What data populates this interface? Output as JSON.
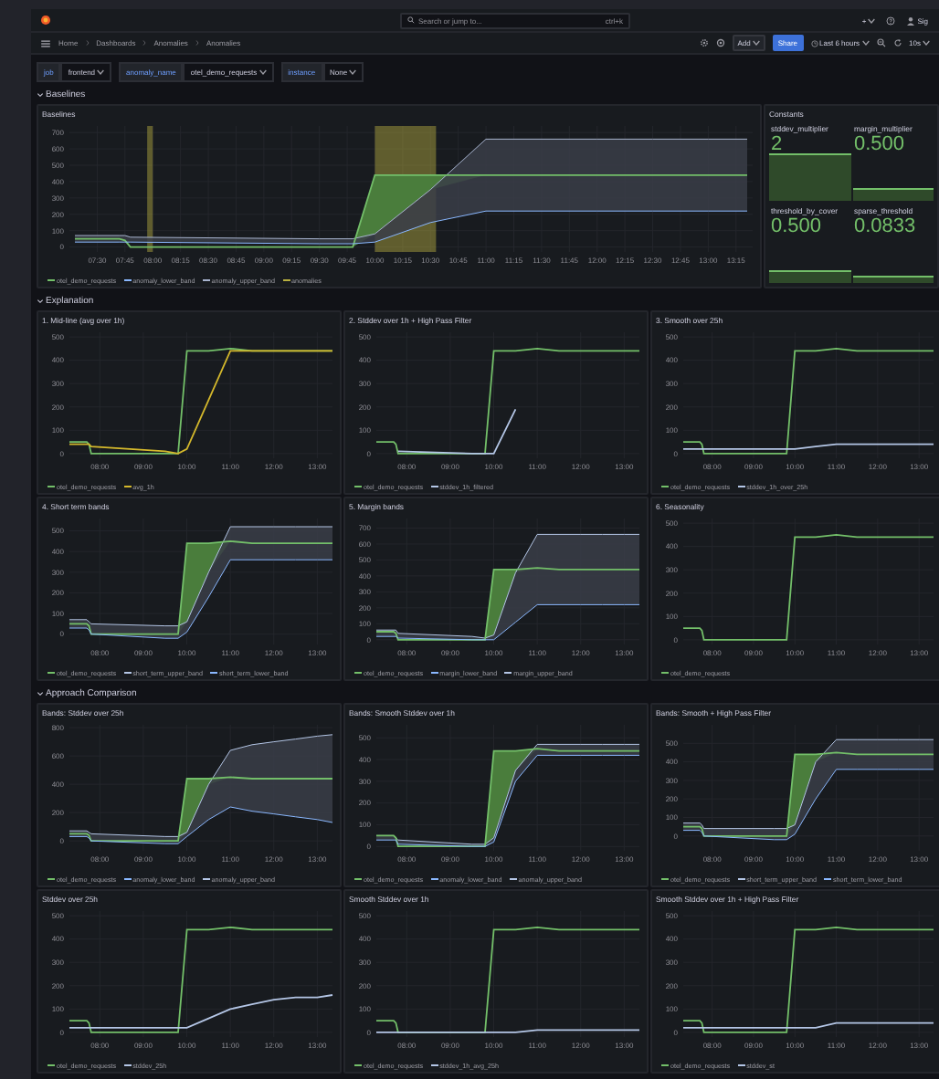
{
  "topbar": {
    "search": {
      "placeholder": "Search or jump to..."
    },
    "shortcut": "ctrl+k",
    "new_button": "+",
    "user": "Sig"
  },
  "toolbar": {
    "breadcrumbs": [
      "Home",
      "Dashboards",
      "Anomalies",
      "Anomalies"
    ],
    "add": "Add",
    "share": "Share",
    "time_range": "Last 6 hours",
    "refresh": "10s"
  },
  "variables": [
    {
      "label": "job",
      "value": "frontend"
    },
    {
      "label": "anomaly_name",
      "value": "otel_demo_requests"
    },
    {
      "label": "instance",
      "value": "None"
    }
  ],
  "rows": [
    {
      "title": "Baselines",
      "expanded": true,
      "panels": [
        {
          "kind": "timeseries",
          "title": "Baselines",
          "chart_data": {
            "type": "line",
            "grid": true,
            "legend": "bottom",
            "x": [
              7.3,
              7.7,
              7.75,
              7.8,
              9.5,
              9.8,
              10,
              10.5,
              11,
              11.5,
              12,
              12.5,
              13,
              13.35
            ],
            "xlim": [
              7.25,
              13.4
            ],
            "ylim": [
              -30,
              740
            ],
            "xticks": [
              {
                "value": 7.5,
                "label": "07:30"
              },
              {
                "value": 7.75,
                "label": "07:45"
              },
              {
                "value": 8,
                "label": "08:00"
              },
              {
                "value": 8.25,
                "label": "08:15"
              },
              {
                "value": 8.5,
                "label": "08:30"
              },
              {
                "value": 8.75,
                "label": "08:45"
              },
              {
                "value": 9,
                "label": "09:00"
              },
              {
                "value": 9.25,
                "label": "09:15"
              },
              {
                "value": 9.5,
                "label": "09:30"
              },
              {
                "value": 9.75,
                "label": "09:45"
              },
              {
                "value": 10,
                "label": "10:00"
              },
              {
                "value": 10.25,
                "label": "10:15"
              },
              {
                "value": 10.5,
                "label": "10:30"
              },
              {
                "value": 10.75,
                "label": "10:45"
              },
              {
                "value": 11,
                "label": "11:00"
              },
              {
                "value": 11.25,
                "label": "11:15"
              },
              {
                "value": 11.5,
                "label": "11:30"
              },
              {
                "value": 11.75,
                "label": "11:45"
              },
              {
                "value": 12,
                "label": "12:00"
              },
              {
                "value": 12.25,
                "label": "12:15"
              },
              {
                "value": 12.5,
                "label": "12:30"
              },
              {
                "value": 12.75,
                "label": "12:45"
              },
              {
                "value": 13,
                "label": "13:00"
              },
              {
                "value": 13.25,
                "label": "13:15"
              }
            ],
            "yticks": [
              0,
              100,
              200,
              300,
              400,
              500,
              600,
              700
            ],
            "series": [
              {
                "name": "otel_demo_requests",
                "color": "#73bf69",
                "values": [
                  50,
                  50,
                  40,
                  0,
                  0,
                  0,
                  440,
                  440,
                  440,
                  440,
                  440,
                  440,
                  440,
                  440
                ]
              },
              {
                "name": "anomaly_lower_band",
                "color": "#8ab8ff",
                "values": [
                  30,
                  30,
                  30,
                  30,
                  20,
                  20,
                  30,
                  150,
                  220,
                  220,
                  220,
                  220,
                  220,
                  220
                ]
              },
              {
                "name": "anomaly_upper_band",
                "type": "area",
                "color": "#a8b4cf",
                "values": [
                  70,
                  70,
                  70,
                  60,
                  50,
                  50,
                  80,
                  350,
                  660,
                  660,
                  660,
                  660,
                  660,
                  660
                ]
              },
              {
                "name": "anomalies",
                "color": "#b8b040",
                "values": [
                  null,
                  null,
                  null,
                  null,
                  null,
                  null,
                  null,
                  null,
                  null,
                  null,
                  null,
                  null,
                  null,
                  null
                ]
              }
            ],
            "bands": [
              {
                "axis": "x",
                "from": 7.95,
                "to": 8.0
              },
              {
                "axis": "x",
                "from": 10.0,
                "to": 10.55
              }
            ]
          }
        },
        {
          "kind": "stats",
          "title": "Constants",
          "stats": [
            {
              "name": "stddev_multiplier",
              "value": "2"
            },
            {
              "name": "margin_multiplier",
              "value": "0.500"
            },
            {
              "name": "threshold_by_cover",
              "value": "0.500"
            },
            {
              "name": "sparse_threshold",
              "value": "0.0833"
            }
          ]
        }
      ]
    },
    {
      "title": "Explanation",
      "expanded": true,
      "panels": [
        {
          "kind": "timeseries",
          "title": "1. Mid-line (avg over 1h)",
          "chart_data": {
            "type": "line",
            "grid": true,
            "legend": "bottom",
            "x": [
              7.3,
              7.7,
              7.75,
              7.8,
              9.5,
              9.8,
              10,
              10.5,
              11,
              11.5,
              12,
              12.5,
              13,
              13.35
            ],
            "xlim": [
              7.3,
              13.35
            ],
            "ylim": [
              -20,
              520
            ],
            "xticks": [
              {
                "value": 8,
                "label": "08:00"
              },
              {
                "value": 9,
                "label": "09:00"
              },
              {
                "value": 10,
                "label": "10:00"
              },
              {
                "value": 11,
                "label": "11:00"
              },
              {
                "value": 12,
                "label": "12:00"
              },
              {
                "value": 13,
                "label": "13:00"
              }
            ],
            "yticks": [
              0,
              100,
              200,
              300,
              400,
              500
            ],
            "series": [
              {
                "name": "otel_demo_requests",
                "color": "#73bf69",
                "values": [
                  50,
                  50,
                  40,
                  0,
                  0,
                  0,
                  440,
                  440,
                  450,
                  440,
                  440,
                  440,
                  440,
                  440
                ]
              },
              {
                "name": "avg_1h",
                "color": "#d4b82c",
                "values": [
                  40,
                  40,
                  40,
                  30,
                  10,
                  0,
                  20,
                  230,
                  440,
                  440,
                  440,
                  440,
                  440,
                  440
                ]
              }
            ]
          }
        },
        {
          "kind": "timeseries",
          "title": "2. Stddev over 1h + High Pass Filter",
          "chart_data": {
            "type": "line",
            "grid": true,
            "legend": "bottom",
            "x": [
              7.3,
              7.7,
              7.75,
              7.8,
              9.5,
              9.8,
              10,
              10.5,
              11,
              11.5,
              12,
              12.5,
              13,
              13.35
            ],
            "xlim": [
              7.3,
              13.35
            ],
            "ylim": [
              -20,
              520
            ],
            "xticks": [
              {
                "value": 8,
                "label": "08:00"
              },
              {
                "value": 9,
                "label": "09:00"
              },
              {
                "value": 10,
                "label": "10:00"
              },
              {
                "value": 11,
                "label": "11:00"
              },
              {
                "value": 12,
                "label": "12:00"
              },
              {
                "value": 13,
                "label": "13:00"
              }
            ],
            "yticks": [
              0,
              100,
              200,
              300,
              400,
              500
            ],
            "series": [
              {
                "name": "otel_demo_requests",
                "color": "#73bf69",
                "values": [
                  50,
                  50,
                  40,
                  0,
                  0,
                  0,
                  440,
                  440,
                  450,
                  440,
                  440,
                  440,
                  440,
                  440
                ]
              },
              {
                "name": "stddev_1h_filtered",
                "color": "#b4c6e6",
                "values": [
                  null,
                  null,
                  null,
                  10,
                  0,
                  0,
                  0,
                  190,
                  null,
                  null,
                  null,
                  null,
                  null,
                  null
                ]
              }
            ]
          }
        },
        {
          "kind": "timeseries",
          "title": "3. Smooth over 25h",
          "chart_data": {
            "type": "line",
            "grid": true,
            "legend": "bottom",
            "x": [
              7.3,
              7.7,
              7.75,
              7.8,
              9.5,
              9.8,
              10,
              10.5,
              11,
              11.5,
              12,
              12.5,
              13,
              13.35
            ],
            "xlim": [
              7.3,
              13.35
            ],
            "ylim": [
              -20,
              520
            ],
            "xticks": [
              {
                "value": 8,
                "label": "08:00"
              },
              {
                "value": 9,
                "label": "09:00"
              },
              {
                "value": 10,
                "label": "10:00"
              },
              {
                "value": 11,
                "label": "11:00"
              },
              {
                "value": 12,
                "label": "12:00"
              },
              {
                "value": 13,
                "label": "13:00"
              }
            ],
            "yticks": [
              0,
              100,
              200,
              300,
              400,
              500
            ],
            "series": [
              {
                "name": "otel_demo_requests",
                "color": "#73bf69",
                "values": [
                  50,
                  50,
                  40,
                  0,
                  0,
                  0,
                  440,
                  440,
                  450,
                  440,
                  440,
                  440,
                  440,
                  440
                ]
              },
              {
                "name": "stddev_1h_over_25h",
                "color": "#b4c6e6",
                "values": [
                  20,
                  20,
                  20,
                  20,
                  20,
                  20,
                  20,
                  30,
                  40,
                  40,
                  40,
                  40,
                  40,
                  40
                ]
              }
            ]
          }
        },
        {
          "kind": "timeseries",
          "title": "4. Short term bands",
          "chart_data": {
            "type": "line",
            "grid": true,
            "legend": "bottom",
            "x": [
              7.3,
              7.7,
              7.75,
              7.8,
              9.5,
              9.8,
              10,
              10.5,
              11,
              11.5,
              12,
              12.5,
              13,
              13.35
            ],
            "xlim": [
              7.3,
              13.35
            ],
            "ylim": [
              -50,
              560
            ],
            "xticks": [
              {
                "value": 8,
                "label": "08:00"
              },
              {
                "value": 9,
                "label": "09:00"
              },
              {
                "value": 10,
                "label": "10:00"
              },
              {
                "value": 11,
                "label": "11:00"
              },
              {
                "value": 12,
                "label": "12:00"
              },
              {
                "value": 13,
                "label": "13:00"
              }
            ],
            "yticks": [
              0,
              100,
              200,
              300,
              400,
              500
            ],
            "series": [
              {
                "name": "otel_demo_requests",
                "color": "#73bf69",
                "values": [
                  50,
                  50,
                  40,
                  0,
                  0,
                  0,
                  440,
                  440,
                  450,
                  440,
                  440,
                  440,
                  440,
                  440
                ]
              },
              {
                "name": "short_term_upper_band",
                "type": "area",
                "color": "#b4c6e6",
                "values": [
                  70,
                  70,
                  60,
                  50,
                  40,
                  40,
                  60,
                  300,
                  520,
                  520,
                  520,
                  520,
                  520,
                  520
                ]
              },
              {
                "name": "short_term_lower_band",
                "color": "#8ab8ff",
                "values": [
                  30,
                  30,
                  20,
                  0,
                  -20,
                  -20,
                  10,
                  180,
                  360,
                  360,
                  360,
                  360,
                  360,
                  360
                ]
              }
            ]
          }
        },
        {
          "kind": "timeseries",
          "title": "5. Margin bands",
          "chart_data": {
            "type": "line",
            "grid": true,
            "legend": "bottom",
            "x": [
              7.3,
              7.7,
              7.75,
              7.8,
              9.5,
              9.8,
              10,
              10.5,
              11,
              11.5,
              12,
              12.5,
              13,
              13.35
            ],
            "xlim": [
              7.3,
              13.35
            ],
            "ylim": [
              -30,
              760
            ],
            "xticks": [
              {
                "value": 8,
                "label": "08:00"
              },
              {
                "value": 9,
                "label": "09:00"
              },
              {
                "value": 10,
                "label": "10:00"
              },
              {
                "value": 11,
                "label": "11:00"
              },
              {
                "value": 12,
                "label": "12:00"
              },
              {
                "value": 13,
                "label": "13:00"
              }
            ],
            "yticks": [
              0,
              100,
              200,
              300,
              400,
              500,
              600,
              700
            ],
            "series": [
              {
                "name": "otel_demo_requests",
                "color": "#73bf69",
                "values": [
                  50,
                  50,
                  40,
                  0,
                  0,
                  0,
                  440,
                  440,
                  450,
                  440,
                  440,
                  440,
                  440,
                  440
                ]
              },
              {
                "name": "margin_lower_band",
                "color": "#8ab8ff",
                "values": [
                  20,
                  20,
                  20,
                  10,
                  0,
                  0,
                  0,
                  110,
                  220,
                  220,
                  220,
                  220,
                  220,
                  220
                ]
              },
              {
                "name": "margin_upper_band",
                "type": "area",
                "color": "#b4c6e6",
                "values": [
                  60,
                  60,
                  60,
                  40,
                  20,
                  10,
                  30,
                  420,
                  660,
                  660,
                  660,
                  660,
                  660,
                  660
                ]
              }
            ]
          }
        },
        {
          "kind": "timeseries",
          "title": "6. Seasonality",
          "chart_data": {
            "type": "line",
            "grid": true,
            "legend": "bottom",
            "x": [
              7.3,
              7.7,
              7.75,
              7.8,
              9.5,
              9.8,
              10,
              10.5,
              11,
              11.5,
              12,
              12.5,
              13,
              13.35
            ],
            "xlim": [
              7.3,
              13.35
            ],
            "ylim": [
              -20,
              520
            ],
            "xticks": [
              {
                "value": 8,
                "label": "08:00"
              },
              {
                "value": 9,
                "label": "09:00"
              },
              {
                "value": 10,
                "label": "10:00"
              },
              {
                "value": 11,
                "label": "11:00"
              },
              {
                "value": 12,
                "label": "12:00"
              },
              {
                "value": 13,
                "label": "13:00"
              }
            ],
            "yticks": [
              0,
              100,
              200,
              300,
              400,
              500
            ],
            "series": [
              {
                "name": "otel_demo_requests",
                "color": "#73bf69",
                "values": [
                  50,
                  50,
                  40,
                  0,
                  0,
                  0,
                  440,
                  440,
                  450,
                  440,
                  440,
                  440,
                  440,
                  440
                ]
              }
            ]
          }
        }
      ]
    },
    {
      "title": "Approach Comparison",
      "expanded": true,
      "panels": [
        {
          "kind": "timeseries",
          "title": "Bands: Stddev over 25h",
          "chart_data": {
            "type": "line",
            "grid": true,
            "legend": "bottom",
            "x": [
              7.3,
              7.7,
              7.75,
              7.8,
              9.5,
              9.8,
              10,
              10.5,
              11,
              11.5,
              12,
              12.5,
              13,
              13.35
            ],
            "xlim": [
              7.3,
              13.35
            ],
            "ylim": [
              -70,
              820
            ],
            "xticks": [
              {
                "value": 8,
                "label": "08:00"
              },
              {
                "value": 9,
                "label": "09:00"
              },
              {
                "value": 10,
                "label": "10:00"
              },
              {
                "value": 11,
                "label": "11:00"
              },
              {
                "value": 12,
                "label": "12:00"
              },
              {
                "value": 13,
                "label": "13:00"
              }
            ],
            "yticks": [
              0,
              200,
              400,
              600,
              800
            ],
            "series": [
              {
                "name": "otel_demo_requests",
                "color": "#73bf69",
                "values": [
                  50,
                  50,
                  40,
                  0,
                  0,
                  0,
                  440,
                  440,
                  450,
                  440,
                  440,
                  440,
                  440,
                  440
                ]
              },
              {
                "name": "anomaly_lower_band",
                "color": "#8ab8ff",
                "values": [
                  30,
                  30,
                  20,
                  0,
                  -20,
                  -20,
                  30,
                  150,
                  240,
                  210,
                  190,
                  170,
                  150,
                  130
                ]
              },
              {
                "name": "anomaly_upper_band",
                "type": "area",
                "color": "#b4c6e6",
                "values": [
                  70,
                  70,
                  60,
                  50,
                  30,
                  30,
                  60,
                  400,
                  640,
                  680,
                  700,
                  720,
                  740,
                  750
                ]
              }
            ]
          }
        },
        {
          "kind": "timeseries",
          "title": "Bands: Smooth Stddev over 1h",
          "chart_data": {
            "type": "line",
            "grid": true,
            "legend": "bottom",
            "x": [
              7.3,
              7.7,
              7.75,
              7.8,
              9.5,
              9.8,
              10,
              10.5,
              11,
              11.5,
              12,
              12.5,
              13,
              13.35
            ],
            "xlim": [
              7.3,
              13.35
            ],
            "ylim": [
              -20,
              560
            ],
            "xticks": [
              {
                "value": 8,
                "label": "08:00"
              },
              {
                "value": 9,
                "label": "09:00"
              },
              {
                "value": 10,
                "label": "10:00"
              },
              {
                "value": 11,
                "label": "11:00"
              },
              {
                "value": 12,
                "label": "12:00"
              },
              {
                "value": 13,
                "label": "13:00"
              }
            ],
            "yticks": [
              0,
              100,
              200,
              300,
              400,
              500
            ],
            "series": [
              {
                "name": "otel_demo_requests",
                "color": "#73bf69",
                "values": [
                  50,
                  50,
                  40,
                  0,
                  0,
                  0,
                  440,
                  440,
                  450,
                  440,
                  440,
                  440,
                  440,
                  440
                ]
              },
              {
                "name": "anomaly_lower_band",
                "color": "#8ab8ff",
                "values": [
                  30,
                  30,
                  30,
                  10,
                  0,
                  0,
                  20,
                  300,
                  420,
                  420,
                  420,
                  420,
                  420,
                  420
                ]
              },
              {
                "name": "anomaly_upper_band",
                "type": "area",
                "color": "#b4c6e6",
                "values": [
                  50,
                  50,
                  40,
                  30,
                  10,
                  10,
                  40,
                  350,
                  470,
                  470,
                  470,
                  470,
                  470,
                  470
                ]
              }
            ]
          }
        },
        {
          "kind": "timeseries",
          "title": "Bands: Smooth + High Pass Filter",
          "chart_data": {
            "type": "line",
            "grid": true,
            "legend": "bottom",
            "x": [
              7.3,
              7.7,
              7.75,
              7.8,
              9.5,
              9.8,
              10,
              10.5,
              11,
              11.5,
              12,
              12.5,
              13,
              13.35
            ],
            "xlim": [
              7.3,
              13.35
            ],
            "ylim": [
              -80,
              600
            ],
            "xticks": [
              {
                "value": 8,
                "label": "08:00"
              },
              {
                "value": 9,
                "label": "09:00"
              },
              {
                "value": 10,
                "label": "10:00"
              },
              {
                "value": 11,
                "label": "11:00"
              },
              {
                "value": 12,
                "label": "12:00"
              },
              {
                "value": 13,
                "label": "13:00"
              }
            ],
            "yticks": [
              0,
              100,
              200,
              300,
              400,
              500
            ],
            "series": [
              {
                "name": "otel_demo_requests",
                "color": "#73bf69",
                "values": [
                  50,
                  50,
                  40,
                  0,
                  0,
                  0,
                  440,
                  440,
                  450,
                  440,
                  440,
                  440,
                  440,
                  440
                ]
              },
              {
                "name": "short_term_upper_band",
                "type": "area",
                "color": "#b4c6e6",
                "values": [
                  70,
                  70,
                  60,
                  40,
                  40,
                  40,
                  60,
                  400,
                  520,
                  520,
                  520,
                  520,
                  520,
                  520
                ]
              },
              {
                "name": "short_term_lower_band",
                "color": "#8ab8ff",
                "values": [
                  30,
                  30,
                  20,
                  0,
                  -20,
                  -20,
                  10,
                  200,
                  360,
                  360,
                  360,
                  360,
                  360,
                  360
                ]
              }
            ]
          }
        },
        {
          "kind": "timeseries",
          "title": "Stddev over 25h",
          "chart_data": {
            "type": "line",
            "grid": true,
            "legend": "bottom",
            "x": [
              7.3,
              7.7,
              7.75,
              7.8,
              9.5,
              9.8,
              10,
              10.5,
              11,
              11.5,
              12,
              12.5,
              13,
              13.35
            ],
            "xlim": [
              7.3,
              13.35
            ],
            "ylim": [
              -20,
              520
            ],
            "xticks": [
              {
                "value": 8,
                "label": "08:00"
              },
              {
                "value": 9,
                "label": "09:00"
              },
              {
                "value": 10,
                "label": "10:00"
              },
              {
                "value": 11,
                "label": "11:00"
              },
              {
                "value": 12,
                "label": "12:00"
              },
              {
                "value": 13,
                "label": "13:00"
              }
            ],
            "yticks": [
              0,
              100,
              200,
              300,
              400,
              500
            ],
            "series": [
              {
                "name": "otel_demo_requests",
                "color": "#73bf69",
                "values": [
                  50,
                  50,
                  40,
                  0,
                  0,
                  0,
                  440,
                  440,
                  450,
                  440,
                  440,
                  440,
                  440,
                  440
                ]
              },
              {
                "name": "stddev_25h",
                "color": "#b4c6e6",
                "values": [
                  20,
                  20,
                  20,
                  20,
                  20,
                  20,
                  20,
                  60,
                  100,
                  120,
                  140,
                  150,
                  150,
                  160
                ]
              }
            ]
          }
        },
        {
          "kind": "timeseries",
          "title": "Smooth Stddev over 1h",
          "chart_data": {
            "type": "line",
            "grid": true,
            "legend": "bottom",
            "x": [
              7.3,
              7.7,
              7.75,
              7.8,
              9.5,
              9.8,
              10,
              10.5,
              11,
              11.5,
              12,
              12.5,
              13,
              13.35
            ],
            "xlim": [
              7.3,
              13.35
            ],
            "ylim": [
              -20,
              520
            ],
            "xticks": [
              {
                "value": 8,
                "label": "08:00"
              },
              {
                "value": 9,
                "label": "09:00"
              },
              {
                "value": 10,
                "label": "10:00"
              },
              {
                "value": 11,
                "label": "11:00"
              },
              {
                "value": 12,
                "label": "12:00"
              },
              {
                "value": 13,
                "label": "13:00"
              }
            ],
            "yticks": [
              0,
              100,
              200,
              300,
              400,
              500
            ],
            "series": [
              {
                "name": "otel_demo_requests",
                "color": "#73bf69",
                "values": [
                  50,
                  50,
                  40,
                  0,
                  0,
                  0,
                  440,
                  440,
                  450,
                  440,
                  440,
                  440,
                  440,
                  440
                ]
              },
              {
                "name": "stddev_1h_avg_25h",
                "color": "#b4c6e6",
                "values": [
                  0,
                  0,
                  0,
                  0,
                  0,
                  0,
                  0,
                  0,
                  10,
                  10,
                  10,
                  10,
                  10,
                  10
                ]
              }
            ]
          }
        },
        {
          "kind": "timeseries",
          "title": "Smooth Stddev over 1h + High Pass Filter",
          "chart_data": {
            "type": "line",
            "grid": true,
            "legend": "bottom",
            "x": [
              7.3,
              7.7,
              7.75,
              7.8,
              9.5,
              9.8,
              10,
              10.5,
              11,
              11.5,
              12,
              12.5,
              13,
              13.35
            ],
            "xlim": [
              7.3,
              13.35
            ],
            "ylim": [
              -20,
              520
            ],
            "xticks": [
              {
                "value": 8,
                "label": "08:00"
              },
              {
                "value": 9,
                "label": "09:00"
              },
              {
                "value": 10,
                "label": "10:00"
              },
              {
                "value": 11,
                "label": "11:00"
              },
              {
                "value": 12,
                "label": "12:00"
              },
              {
                "value": 13,
                "label": "13:00"
              }
            ],
            "yticks": [
              0,
              100,
              200,
              300,
              400,
              500
            ],
            "series": [
              {
                "name": "otel_demo_requests",
                "color": "#73bf69",
                "values": [
                  50,
                  50,
                  40,
                  0,
                  0,
                  0,
                  440,
                  440,
                  450,
                  440,
                  440,
                  440,
                  440,
                  440
                ]
              },
              {
                "name": "stddev_st",
                "color": "#b4c6e6",
                "values": [
                  20,
                  20,
                  20,
                  20,
                  20,
                  20,
                  20,
                  20,
                  40,
                  40,
                  40,
                  40,
                  40,
                  40
                ]
              }
            ]
          }
        }
      ]
    }
  ]
}
